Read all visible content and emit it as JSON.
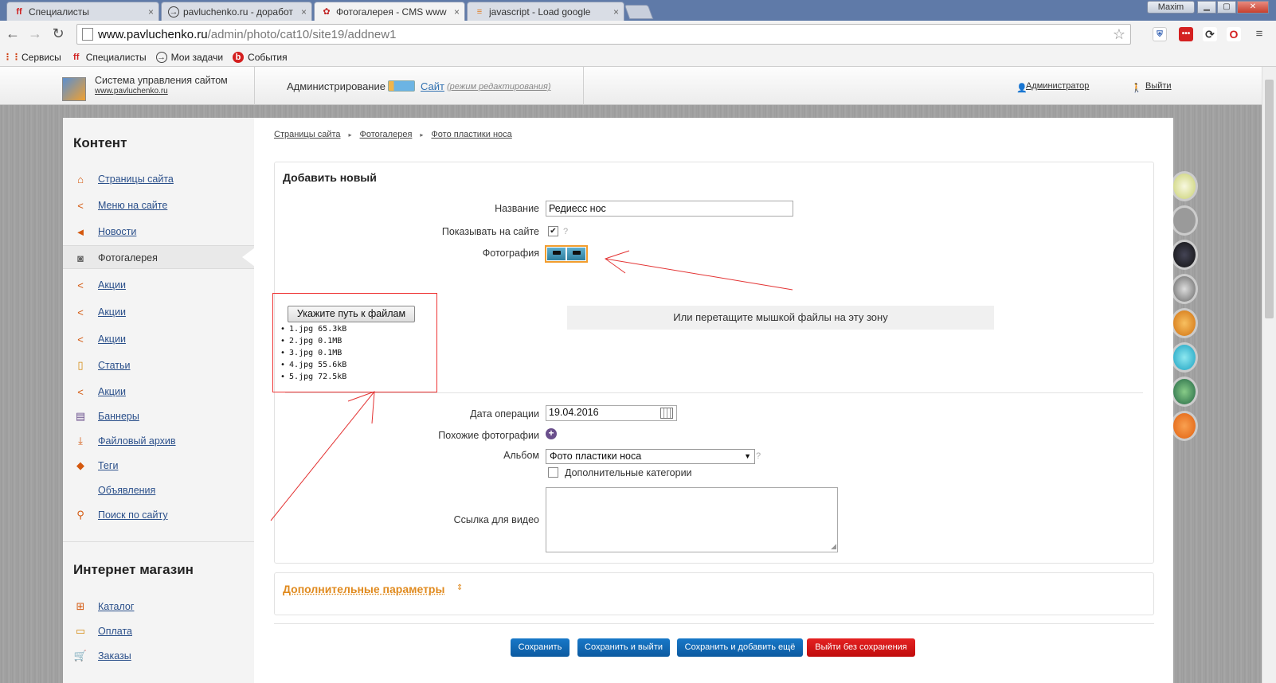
{
  "browser": {
    "tabs": [
      {
        "label": "Специалисты",
        "icon": "fl-icon"
      },
      {
        "label": "pavluchenko.ru - доработ",
        "icon": "arrow-circle-icon"
      },
      {
        "label": "Фотогалерея - CMS www",
        "icon": "cms-icon"
      },
      {
        "label": "javascript - Load google",
        "icon": "stackoverflow-icon"
      }
    ],
    "active_tab": 2,
    "user": "Maxim",
    "url_host": "www.pavluchenko.ru",
    "url_path": "/admin/photo/cat10/site19/addnew1",
    "bookmarks": [
      {
        "label": "Сервисы",
        "icon": "apps-icon"
      },
      {
        "label": "Специалисты",
        "icon": "fl-icon"
      },
      {
        "label": "Мои задачи",
        "icon": "arrow-circle-icon"
      },
      {
        "label": "События",
        "icon": "events-icon"
      }
    ]
  },
  "header": {
    "system_title": "Система управления сайтом",
    "system_url": "www.pavluchenko.ru",
    "admin_label": "Администрирование",
    "site_link": "Сайт",
    "mode_label": "(режим редактирования)",
    "user_link": "Администратор",
    "exit_link": "Выйти"
  },
  "sidebar": {
    "content_heading": "Контент",
    "items": [
      {
        "label": "Страницы сайта",
        "icon": "home-icon"
      },
      {
        "label": "Меню на сайте",
        "icon": "share-icon"
      },
      {
        "label": "Новости",
        "icon": "megaphone-icon"
      },
      {
        "label": "Фотогалерея",
        "icon": "camera-icon"
      },
      {
        "label": "Акции",
        "icon": "share-icon"
      },
      {
        "label": "Акции",
        "icon": "share-icon"
      },
      {
        "label": "Акции",
        "icon": "share-icon"
      },
      {
        "label": "Статьи",
        "icon": "book-icon"
      },
      {
        "label": "Акции",
        "icon": "share-icon"
      },
      {
        "label": "Баннеры",
        "icon": "banner-icon"
      },
      {
        "label": "Файловый архив",
        "icon": "download-icon"
      },
      {
        "label": "Теги",
        "icon": "tag-icon"
      },
      {
        "label": "Объявления",
        "icon": ""
      },
      {
        "label": "Поиск по сайту",
        "icon": "search-icon"
      }
    ],
    "active_index": 3,
    "shop_heading": "Интернет магазин",
    "shop_items": [
      {
        "label": "Каталог",
        "icon": "catalog-icon"
      },
      {
        "label": "Оплата",
        "icon": "payment-icon"
      },
      {
        "label": "Заказы",
        "icon": "cart-icon"
      }
    ]
  },
  "breadcrumb": [
    "Страницы сайта",
    "Фотогалерея",
    "Фото пластики носа"
  ],
  "form": {
    "title": "Добавить новый",
    "name_label": "Название",
    "name_value": "Редиесс нос",
    "show_label": "Показывать на сайте",
    "show_checked": true,
    "help_mark": "?",
    "photo_label": "Фотография",
    "upload_button": "Укажите путь к файлам",
    "files": [
      "1.jpg 65.3kB",
      "2.jpg 0.1MB",
      "3.jpg 0.1MB",
      "4.jpg 55.6kB",
      "5.jpg 72.5kB"
    ],
    "dropzone_text": "Или перетащите мышкой файлы на эту зону",
    "date_label": "Дата операции",
    "date_value": "19.04.2016",
    "similar_label": "Похожие фотографии",
    "album_label": "Альбом",
    "album_value": "Фото пластики носа",
    "extra_categories_label": "Дополнительные категории",
    "video_label": "Ссылка для видео",
    "extra_params": "Дополнительные параметры"
  },
  "buttons": {
    "save": "Сохранить",
    "save_exit": "Сохранить и выйти",
    "save_add": "Сохранить и добавить ещё",
    "exit_nosave": "Выйти без сохранения"
  },
  "colors": {
    "accent_orange": "#e08a1e",
    "button_blue": "#1068b8",
    "button_red": "#d41616",
    "annotation_red": "#e33333"
  }
}
